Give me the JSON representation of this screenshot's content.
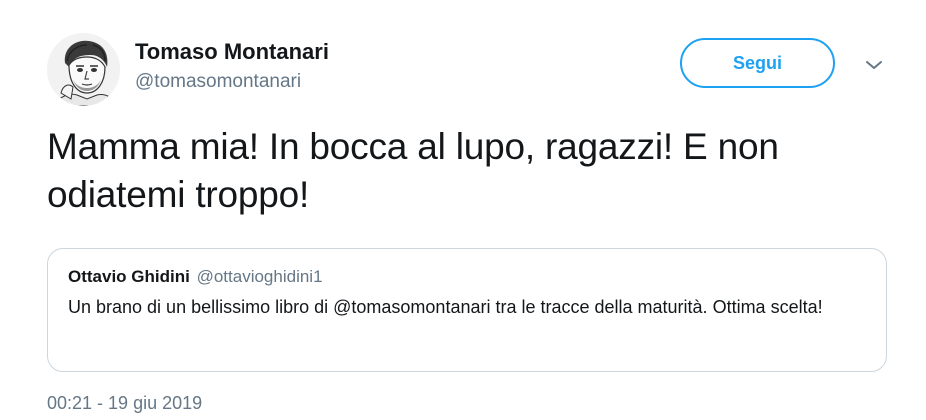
{
  "author": {
    "name": "Tomaso Montanari",
    "handle": "@tomasomontanari"
  },
  "follow_button": {
    "label": "Segui"
  },
  "tweet": {
    "text": "Mamma mia! In bocca al lupo, ragazzi! E non odiatemi troppo!",
    "timestamp": "00:21 - 19 giu 2019"
  },
  "quoted_tweet": {
    "name": "Ottavio Ghidini",
    "handle": "@ottavioghidini1",
    "text": "Un brano di un bellissimo libro di @tomasomontanari tra le tracce della maturità. Ottima scelta!"
  },
  "colors": {
    "accent": "#1da1f2",
    "secondary_text": "#657786",
    "border": "#ccd6dd"
  },
  "icons": {
    "more": "chevron-down-icon",
    "avatar": "sketch-portrait-avatar"
  }
}
